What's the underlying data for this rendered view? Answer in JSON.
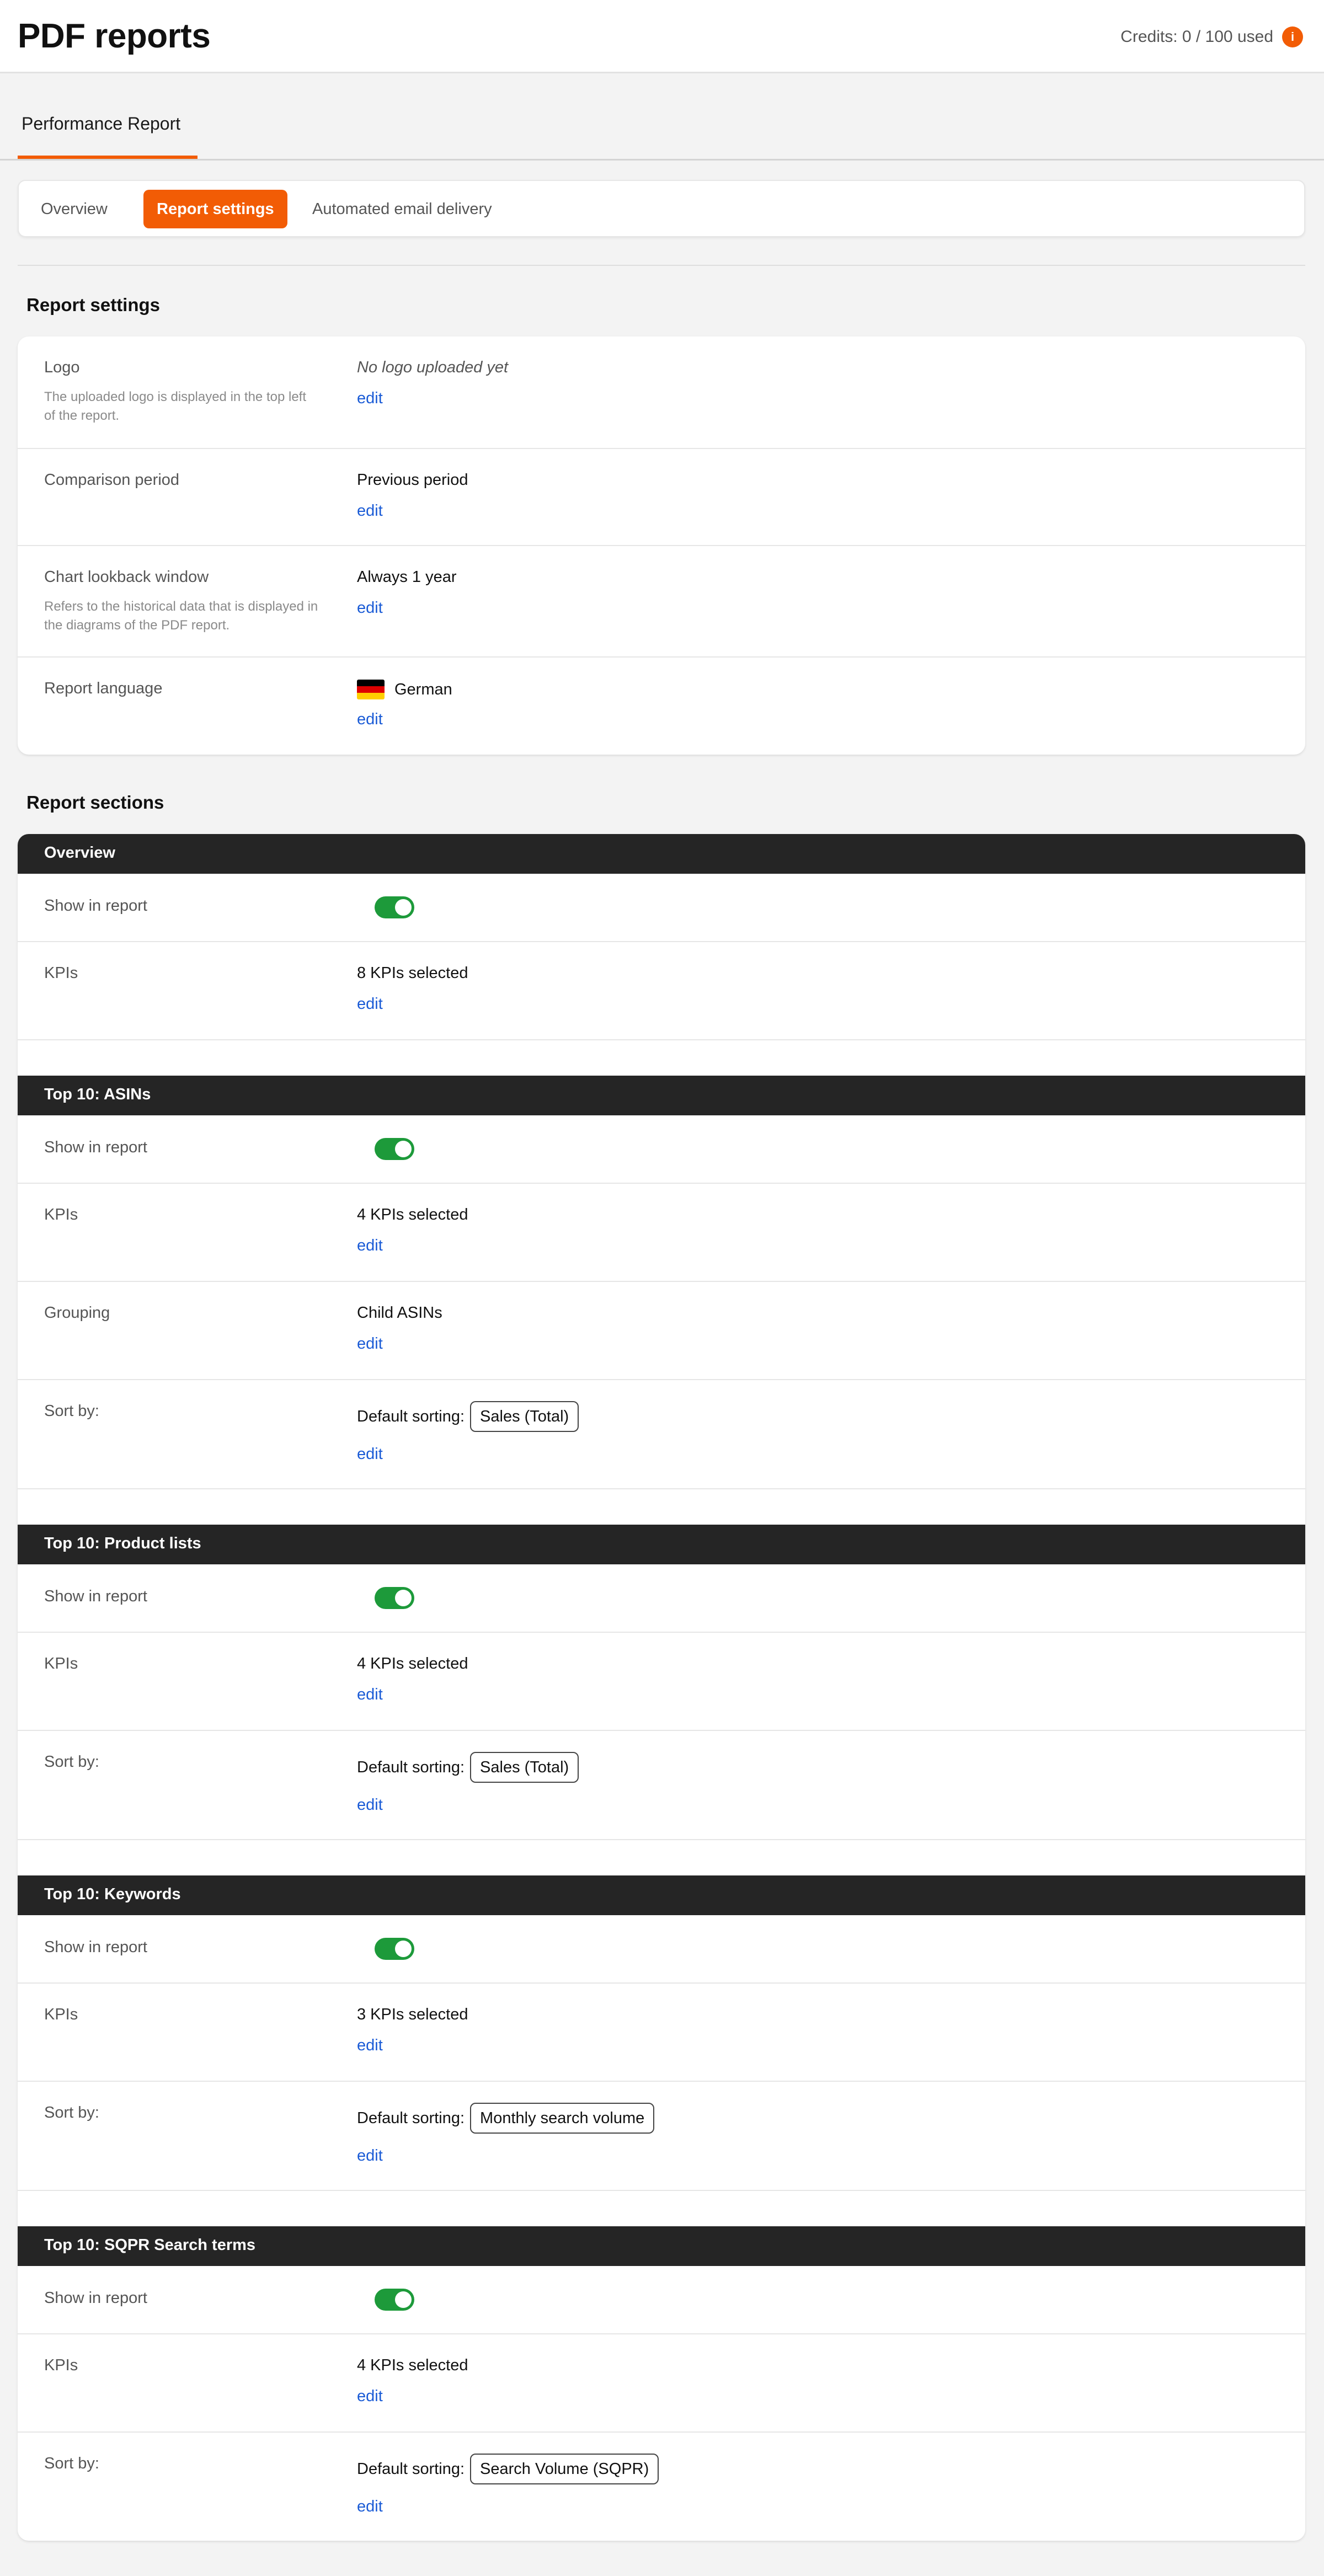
{
  "header": {
    "title": "PDF reports",
    "credits": "Credits: 0 / 100 used",
    "info_icon": "i"
  },
  "report_tab": {
    "label": "Performance Report"
  },
  "subtabs": [
    {
      "label": "Overview",
      "active": false
    },
    {
      "label": "Report settings",
      "active": true
    },
    {
      "label": "Automated email delivery",
      "active": false
    }
  ],
  "settings": {
    "heading": "Report settings",
    "logo": {
      "label": "Logo",
      "description_line1": "The uploaded logo is displayed in the top left",
      "description_line2": "of the report.",
      "value": "No logo uploaded yet",
      "edit": "edit"
    },
    "comparison": {
      "label": "Comparison period",
      "value": "Previous period",
      "edit": "edit"
    },
    "lookback": {
      "label": "Chart lookback window",
      "description_line1": "Refers to the historical data that is displayed in",
      "description_line2": "the diagrams of the PDF report.",
      "value": "Always 1 year",
      "edit": "edit"
    },
    "language": {
      "label": "Report language",
      "value": "German",
      "flag_icon": "germany-flag-icon",
      "edit": "edit"
    }
  },
  "sections": {
    "heading": "Report sections",
    "show_label": "Show in report",
    "kpis_label": "KPIs",
    "grouping_label": "Grouping",
    "sort_label": "Sort by:",
    "default_sorting": "Default sorting:",
    "edit": "edit",
    "overview": {
      "title": "Overview",
      "kpis": "8 KPIs selected",
      "show": true
    },
    "asins": {
      "title": "Top 10: ASINs",
      "kpis": "4 KPIs selected",
      "grouping": "Child ASINs",
      "sort": "Sales (Total)",
      "show": true
    },
    "product_lists": {
      "title": "Top 10: Product lists",
      "kpis": "4 KPIs selected",
      "sort": "Sales (Total)",
      "show": true
    },
    "keywords": {
      "title": "Top 10: Keywords",
      "kpis": "3 KPIs selected",
      "sort": "Monthly search volume",
      "show": true
    },
    "sqpr": {
      "title": "Top 10: SQPR Search terms",
      "kpis": "4 KPIs selected",
      "sort": "Search Volume (SQPR)",
      "show": true
    }
  },
  "colors": {
    "accent": "#f25c05",
    "link": "#1a5bd6",
    "toggle_on": "#1d9a3a",
    "section_bar": "#252525"
  }
}
